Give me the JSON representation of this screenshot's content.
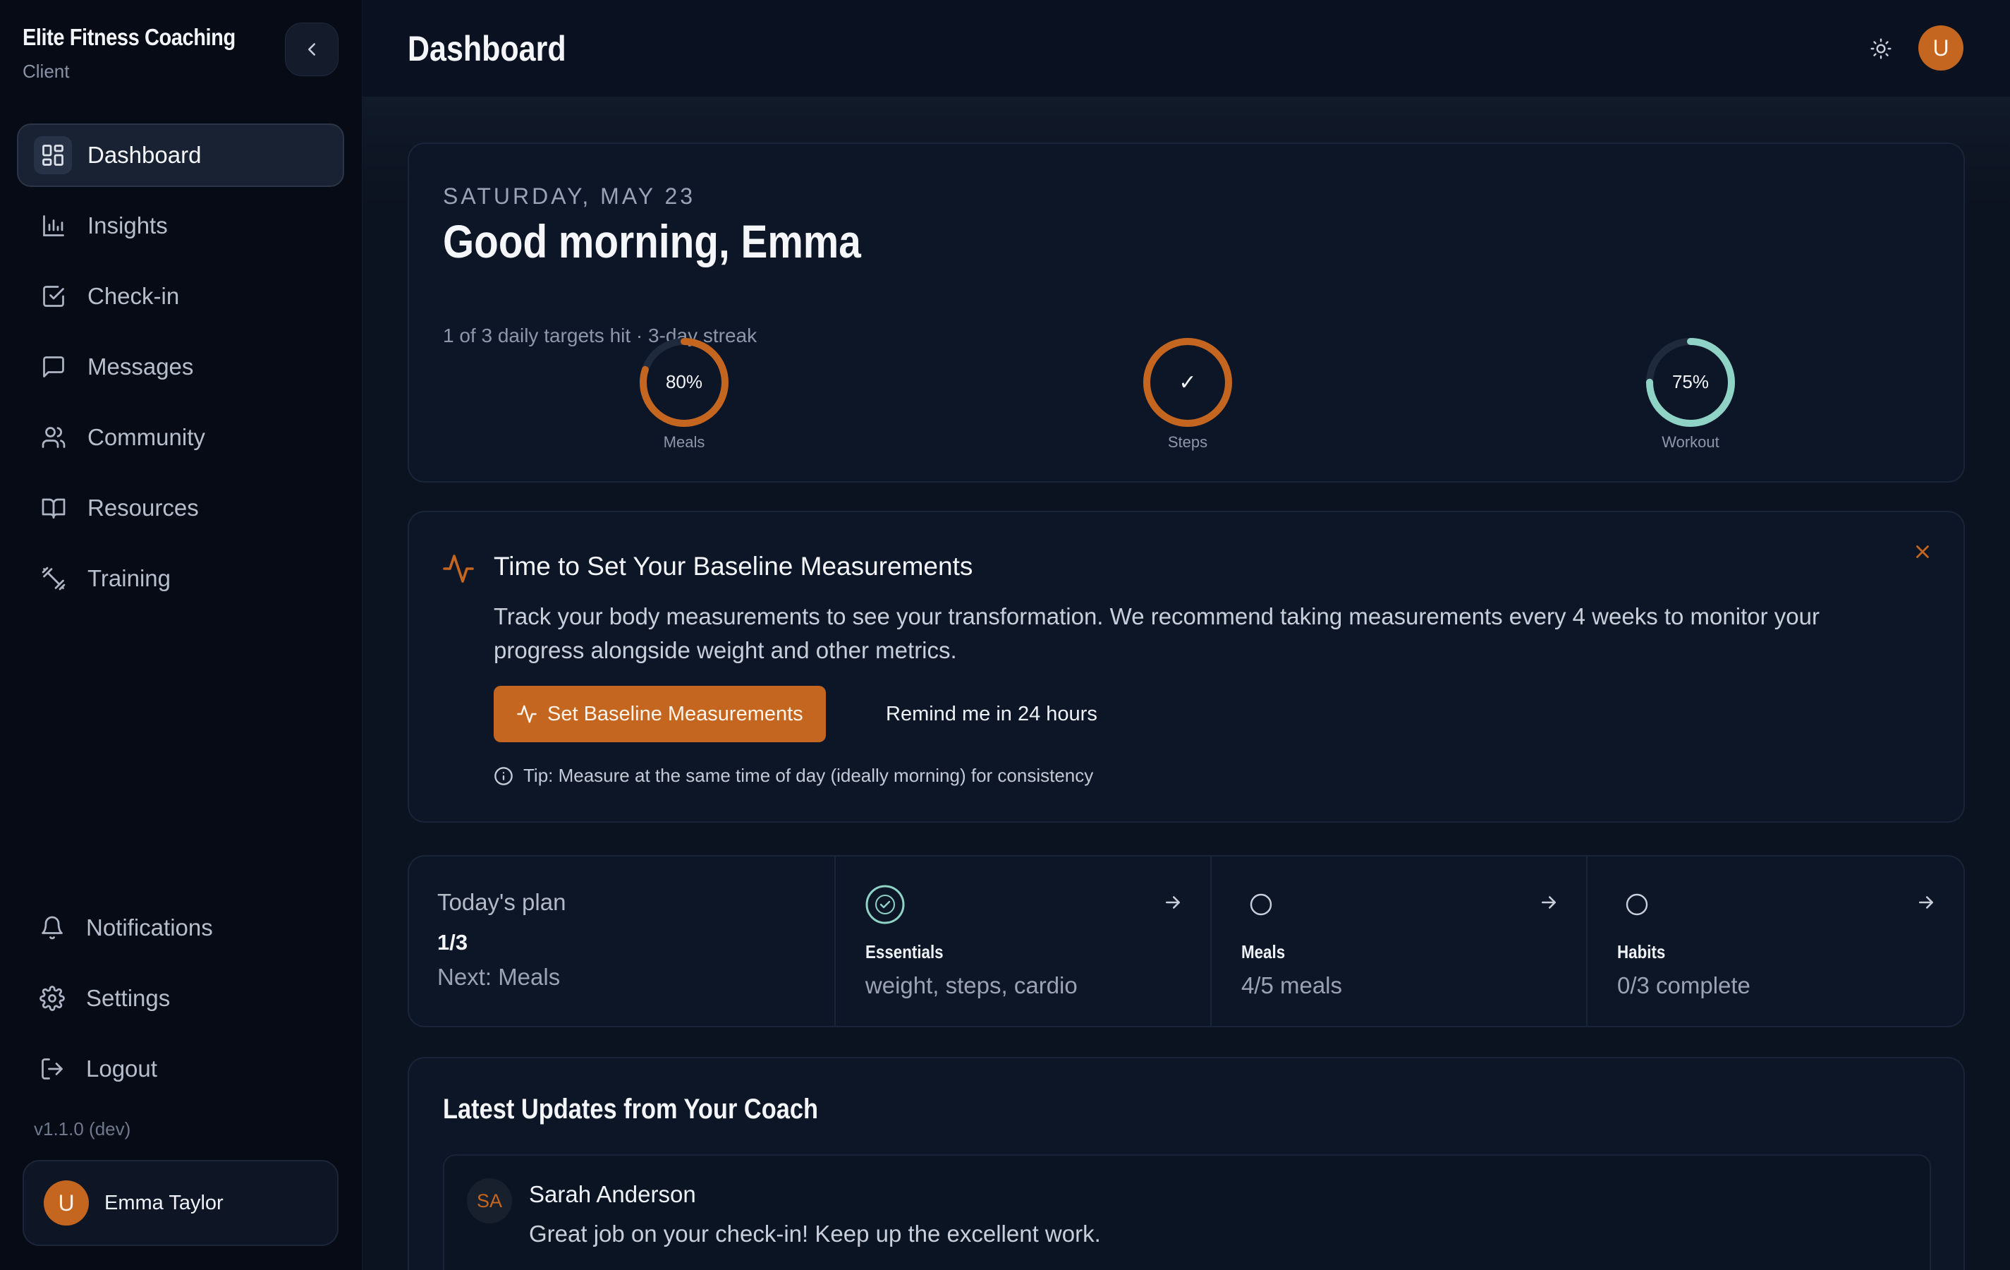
{
  "brand": {
    "title": "Elite Fitness Coaching",
    "subtitle": "Client"
  },
  "sidebar": {
    "items": [
      {
        "label": "Dashboard",
        "icon": "dashboard-grid-icon",
        "active": true
      },
      {
        "label": "Insights",
        "icon": "bar-chart-icon"
      },
      {
        "label": "Check-in",
        "icon": "checkbox-icon"
      },
      {
        "label": "Messages",
        "icon": "message-icon"
      },
      {
        "label": "Community",
        "icon": "users-icon"
      },
      {
        "label": "Resources",
        "icon": "book-icon"
      },
      {
        "label": "Training",
        "icon": "dumbbell-icon"
      }
    ],
    "bottom_items": [
      {
        "label": "Notifications",
        "icon": "bell-icon"
      },
      {
        "label": "Settings",
        "icon": "gear-icon"
      },
      {
        "label": "Logout",
        "icon": "logout-icon"
      }
    ],
    "version": "v1.1.0 (dev)",
    "user": {
      "initial": "U",
      "name": "Emma Taylor"
    }
  },
  "header": {
    "title": "Dashboard",
    "avatar_initial": "U"
  },
  "hero": {
    "date": "SATURDAY, MAY 23",
    "greeting": "Good morning, Emma",
    "subline": "1 of 3 daily targets hit · 3-day streak",
    "rings": [
      {
        "label": "Meals",
        "value_text": "80%",
        "progress": 0.8,
        "color": "#c4661f"
      },
      {
        "label": "Steps",
        "value_text": "✓",
        "progress": 1.0,
        "color": "#c4661f"
      },
      {
        "label": "Workout",
        "value_text": "75%",
        "progress": 0.75,
        "color": "#8fd3c7"
      }
    ]
  },
  "banner": {
    "title": "Time to Set Your Baseline Measurements",
    "text": "Track your body measurements to see your transformation. We recommend taking measurements every 4 weeks to monitor your progress alongside weight and other metrics.",
    "primary_button": "Set Baseline Measurements",
    "secondary_button": "Remind me in 24 hours",
    "tip": "Tip: Measure at the same time of day (ideally morning) for consistency"
  },
  "plan": {
    "title": "Today's plan",
    "count": "1/3",
    "next": "Next: Meals",
    "steps": [
      {
        "title": "Essentials",
        "desc": "weight, steps, cardio",
        "done": true
      },
      {
        "title": "Meals",
        "desc": "4/5 meals",
        "done": false
      },
      {
        "title": "Habits",
        "desc": "0/3 complete",
        "done": false
      }
    ]
  },
  "updates": {
    "title": "Latest Updates from Your Coach",
    "messages": [
      {
        "initials": "SA",
        "name": "Sarah Anderson",
        "text": "Great job on your check-in! Keep up the excellent work."
      }
    ]
  },
  "colors": {
    "accent": "#c4661f",
    "teal": "#8fd3c7",
    "background": "#0b1220"
  }
}
